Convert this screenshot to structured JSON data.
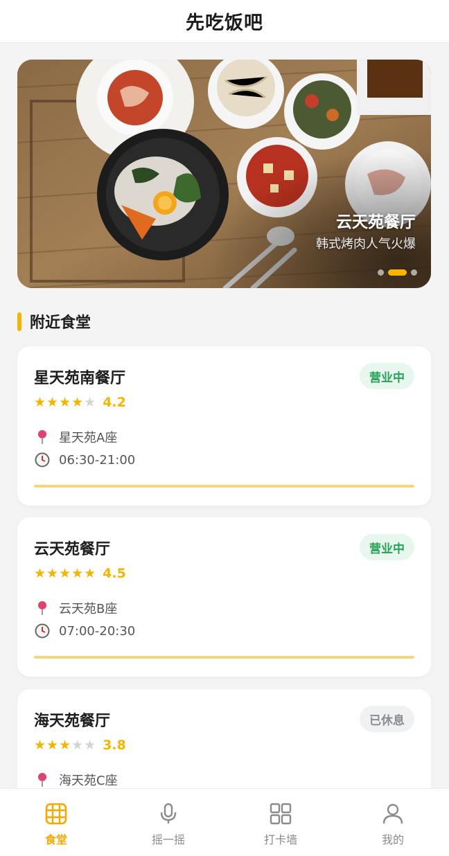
{
  "header": {
    "title": "先吃饭吧"
  },
  "banner": {
    "title": "云天苑餐厅",
    "subtitle": "韩式烤肉人气火爆",
    "slide_count": 3,
    "active_slide": 2
  },
  "section": {
    "title": "附近食堂"
  },
  "restaurants": [
    {
      "name": "星天苑南餐厅",
      "status": "营业中",
      "status_type": "open",
      "stars": "★★★★",
      "stars_off": "★",
      "rating": "4.2",
      "location": "星天苑A座",
      "hours": "06:30-21:00"
    },
    {
      "name": "云天苑餐厅",
      "status": "营业中",
      "status_type": "open",
      "stars": "★★★★★",
      "stars_off": "",
      "rating": "4.5",
      "location": "云天苑B座",
      "hours": "07:00-20:30"
    },
    {
      "name": "海天苑餐厅",
      "status": "已休息",
      "status_type": "closed",
      "stars": "★★★",
      "stars_off": "★★",
      "rating": "3.8",
      "location": "海天苑C座",
      "hours": ""
    }
  ],
  "tabbar": {
    "items": [
      {
        "label": "食堂",
        "icon": "canteen-grid-icon",
        "active": true
      },
      {
        "label": "摇一摇",
        "icon": "microphone-icon",
        "active": false
      },
      {
        "label": "打卡墙",
        "icon": "grid-icon",
        "active": false
      },
      {
        "label": "我的",
        "icon": "user-icon",
        "active": false
      }
    ]
  },
  "colors": {
    "accent": "#f5b400",
    "open_green": "#27a357",
    "closed_gray": "#8a8d93"
  }
}
